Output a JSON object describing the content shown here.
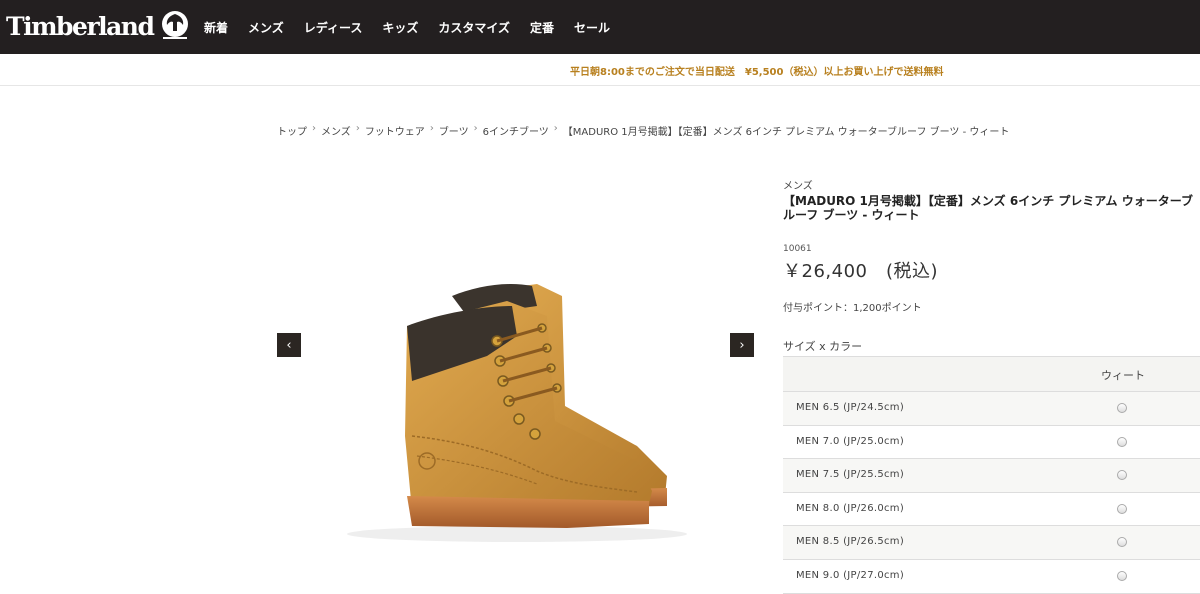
{
  "header": {
    "logo_text": "Timberland",
    "nav": [
      "新着",
      "メンズ",
      "レディース",
      "キッズ",
      "カスタマイズ",
      "定番",
      "セール"
    ]
  },
  "notice": "平日朝8:00までのご注文で当日配送　¥5,500（税込）以上お買い上げで送料無料",
  "breadcrumb": [
    "トップ",
    "メンズ",
    "フットウェア",
    "ブーツ",
    "6インチブーツ",
    "【MADURO 1月号掲載】【定番】メンズ 6インチ プレミアム ウォーターブルーフ ブーツ - ウィート"
  ],
  "gallery": {
    "prev": "‹",
    "next": "›"
  },
  "product": {
    "category": "メンズ",
    "title": "【MADURO 1月号掲載】【定番】メンズ 6インチ プレミアム ウォーターブルーフ ブーツ - ウィート",
    "sku": "10061",
    "price": "￥26,400　(税込)",
    "points": "付与ポイント：1,200ポイント",
    "size_label": "サイズ x カラー"
  },
  "size_table": {
    "color_header": "ウィート",
    "sizes": [
      "MEN 6.5 (JP/24.5cm)",
      "MEN 7.0 (JP/25.0cm)",
      "MEN 7.5 (JP/25.5cm)",
      "MEN 8.0 (JP/26.0cm)",
      "MEN 8.5 (JP/26.5cm)",
      "MEN 9.0 (JP/27.0cm)"
    ]
  },
  "colors": {
    "header_bg": "#231f20",
    "notice": "#b8801f",
    "boot": "#c8923e"
  }
}
